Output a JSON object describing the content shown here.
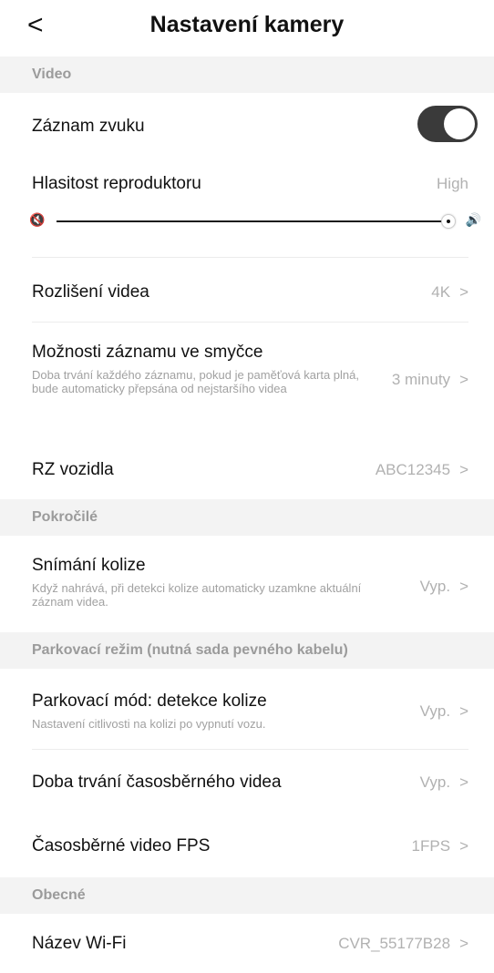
{
  "header": {
    "back_glyph": "<",
    "title": "Nastavení kamery"
  },
  "sections": {
    "video": "Video",
    "advanced": "Pokročilé",
    "parking": "Parkovací režim (nutná sada pevného kabelu)",
    "general": "Obecné"
  },
  "audio_record": {
    "label": "Záznam zvuku",
    "enabled": true
  },
  "speaker_volume": {
    "label": "Hlasitost reproduktoru",
    "value": "High",
    "level": 1.0,
    "icons": [
      "speaker-muted-icon",
      "speaker-loud-icon"
    ]
  },
  "resolution": {
    "label": "Rozlišení videa",
    "value": "4K"
  },
  "loop_recording": {
    "label": "Možnosti záznamu ve smyčce",
    "description": "Doba trvání každého záznamu, pokud je paměťová karta plná, bude automaticky přepsána od nejstaršího videa",
    "value": "3 minuty"
  },
  "plate": {
    "label": "RZ vozidla",
    "value": "ABC12345"
  },
  "collision": {
    "label": "Snímání kolize",
    "description": "Když nahrává, při detekci kolize automaticky uzamkne aktuální záznam videa.",
    "value": "Vyp."
  },
  "parking_collision": {
    "label": "Parkovací mód: detekce kolize",
    "description": "Nastavení citlivosti na kolizi po vypnutí vozu.",
    "value": "Vyp."
  },
  "timelapse_duration": {
    "label": "Doba trvání časosběrného videa",
    "value": "Vyp."
  },
  "timelapse_fps": {
    "label": "Časosběrné video FPS",
    "value": "1FPS"
  },
  "wifi_name": {
    "label": "Název Wi-Fi",
    "value": "CVR_55177B28"
  },
  "chevron": ">",
  "colors": {
    "toggle_on": "#3a3a3a",
    "section_bg": "#f3f3f3",
    "secondary_text": "#b1b1b1"
  }
}
